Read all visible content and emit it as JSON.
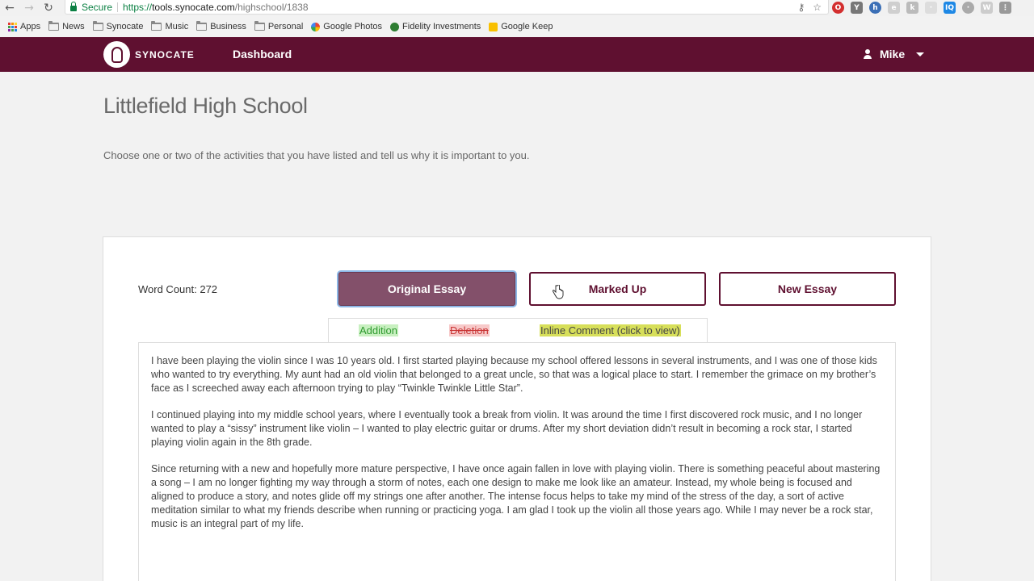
{
  "browser": {
    "secure_label": "Secure",
    "url_proto": "https://",
    "url_host": "tools.synocate.com",
    "url_path": "/highschool/1838",
    "bookmarks": [
      {
        "label": "Apps"
      },
      {
        "label": "News"
      },
      {
        "label": "Synocate"
      },
      {
        "label": "Music"
      },
      {
        "label": "Business"
      },
      {
        "label": "Personal"
      },
      {
        "label": "Google Photos"
      },
      {
        "label": "Fidelity Investments"
      },
      {
        "label": "Google Keep"
      }
    ]
  },
  "navbar": {
    "brand": "SYNOCATE",
    "dashboard_label": "Dashboard",
    "user_name": "Mike",
    "color": "#5f1030"
  },
  "page": {
    "title": "Littlefield High School",
    "prompt": "Choose one or two of the activities that you have listed and tell us why it is important to you."
  },
  "essay_panel": {
    "word_count": "Word Count: 272",
    "buttons": {
      "original": "Original Essay",
      "marked_up": "Marked Up",
      "new_essay": "New Essay"
    },
    "legend": {
      "addition": "Addition",
      "deletion": "Deletion",
      "comment": "Inline Comment (click to view)"
    },
    "paragraphs": [
      "I have been playing the violin since I was 10 years old. I first started playing because my school offered lessons in several instruments, and I was one of those kids who wanted to try everything. My aunt had an old violin that belonged to a great uncle, so that was a logical place to start. I remember the grimace on my brother’s face as I screeched away each afternoon trying to play “Twinkle Twinkle Little Star”.",
      "I continued playing into my middle school years, where I eventually took a break from violin. It was around the time I first discovered rock music, and I no longer wanted to play a “sissy” instrument like violin – I wanted to play electric guitar or drums. After my short deviation didn’t result in becoming a rock star, I started playing violin again in the 8th grade.",
      "Since returning with a new and hopefully more mature perspective, I have once again fallen in love with playing violin. There is something peaceful about mastering a song – I am no longer fighting my way through a storm of notes, each one design to make me look like an amateur. Instead, my whole being is focused and aligned to produce a story, and notes glide off my strings one after another. The intense focus helps to take my mind of the stress of the day, a sort of active meditation similar to what my friends describe when running or practicing yoga.  I am glad I took up the violin all those years ago. While I may never be a rock star, music is an integral part of my life."
    ]
  }
}
